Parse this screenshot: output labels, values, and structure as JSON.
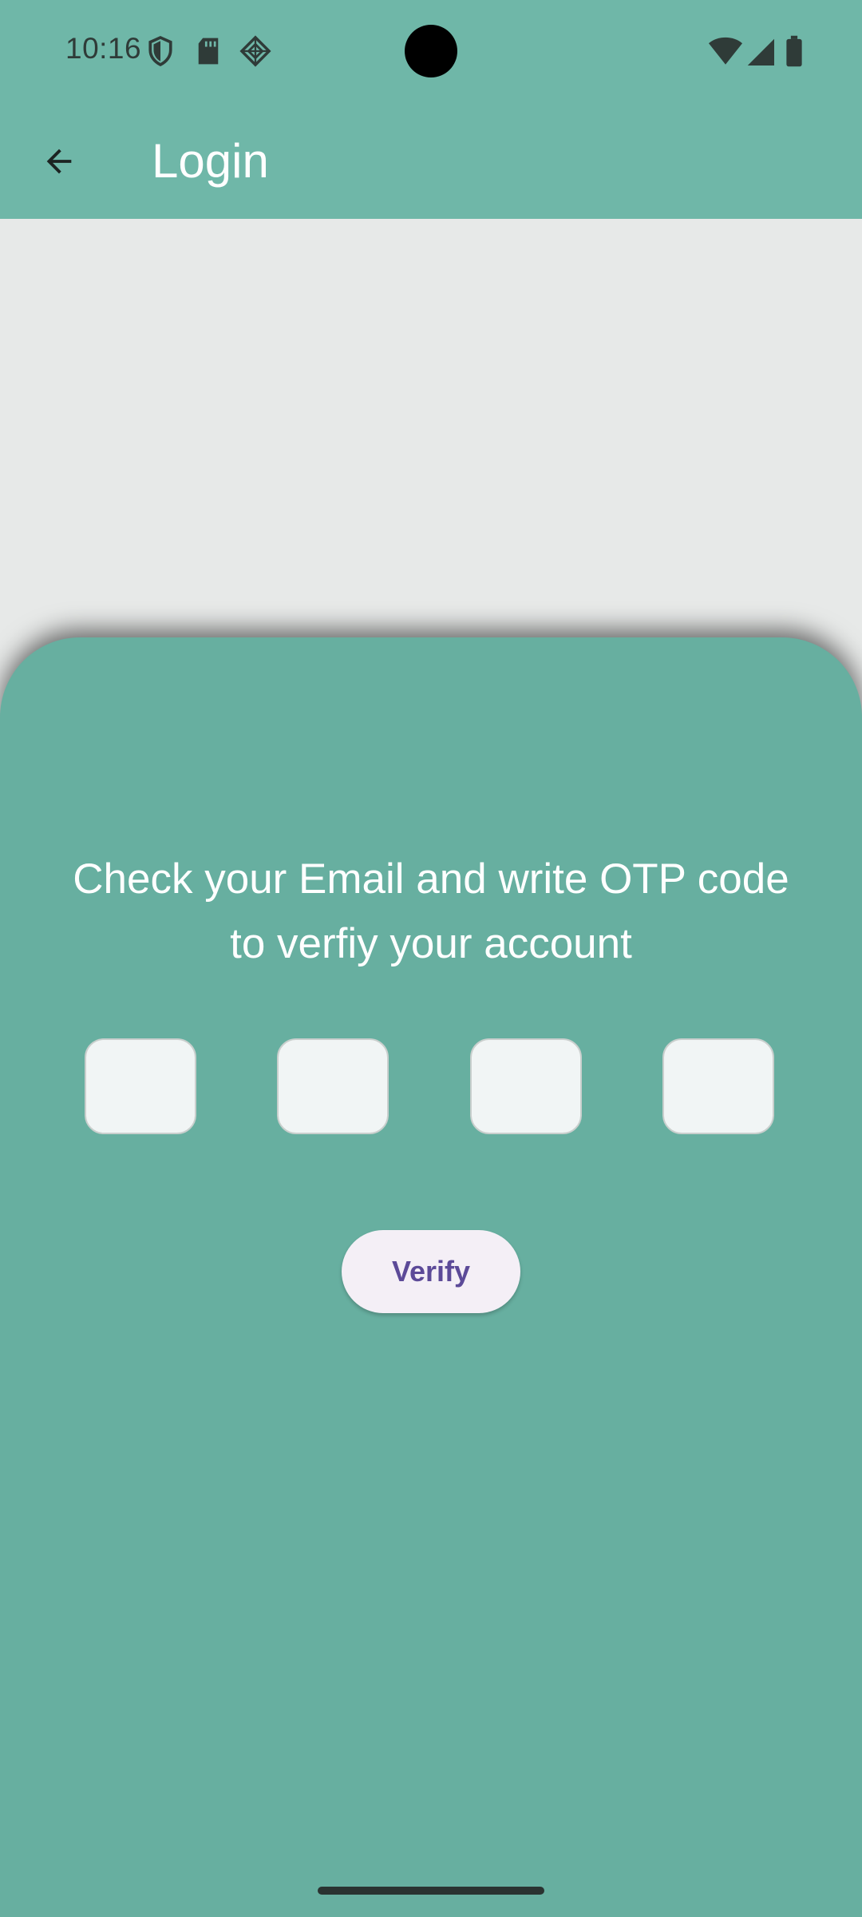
{
  "status_bar": {
    "time": "10:16",
    "left_icons": [
      "shield-icon",
      "sd-card-icon",
      "app-notification-icon"
    ],
    "right_icons": [
      "wifi-icon",
      "cellular-signal-icon",
      "battery-icon"
    ]
  },
  "app_bar": {
    "title": "Login",
    "back_icon": "arrow-back-icon",
    "background_color": "#6fb7a8"
  },
  "otp_sheet": {
    "instruction": "Check your Email and write OTP code to verfiy your account",
    "digits": [
      "",
      "",
      "",
      ""
    ],
    "verify_label": "Verify",
    "background_color": "#67afa0"
  },
  "colors": {
    "page_background": "#e7e9e8",
    "verify_text": "#5c4a98",
    "verify_background": "#f4eff6"
  }
}
